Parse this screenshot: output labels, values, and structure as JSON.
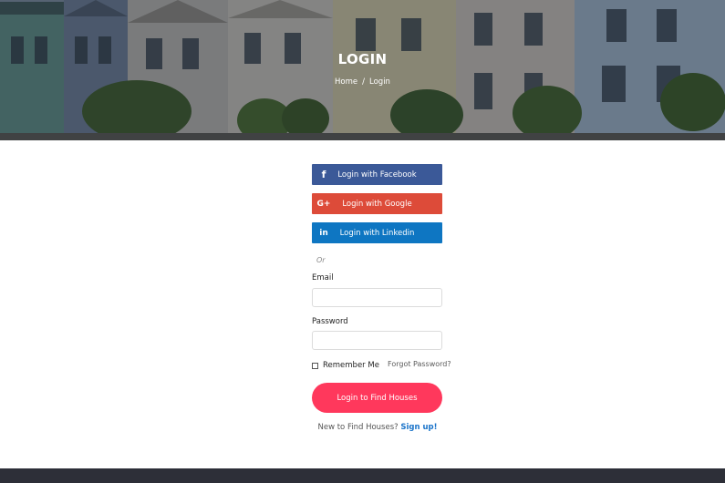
{
  "hero": {
    "title": "LOGIN",
    "breadcrumb": {
      "home": "Home",
      "separator": "/",
      "current": "Login"
    }
  },
  "social": {
    "facebook": {
      "label": "Login with Facebook",
      "icon_glyph": "f",
      "icon": "facebook-icon",
      "color": "#3b5998"
    },
    "google": {
      "label": "Login with Google",
      "icon_glyph": "G+",
      "icon": "google-plus-icon",
      "color": "#dd4b39"
    },
    "linkedin": {
      "label": "Login with Linkedin",
      "icon_glyph": "in",
      "icon": "linkedin-icon",
      "color": "#0e76c2"
    }
  },
  "divider_text": "Or",
  "form": {
    "email_label": "Email",
    "email_value": "",
    "password_label": "Password",
    "password_value": "",
    "remember_label": "Remember Me",
    "remember_checked": false,
    "forgot_label": "Forgot Password?",
    "submit_label": "Login to Find Houses"
  },
  "signup": {
    "prompt": "New to Find Houses?",
    "link_label": "Sign up!"
  },
  "colors": {
    "accent": "#ff385c",
    "link": "#1a73c9",
    "footer": "#2d2f38"
  }
}
